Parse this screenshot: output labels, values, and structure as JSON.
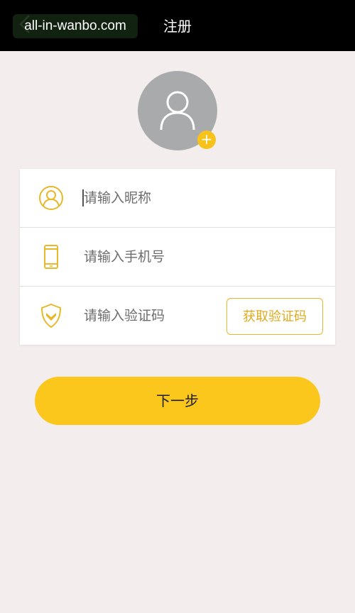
{
  "header": {
    "back_icon": "chevron-left-icon",
    "watermark": "all-in-wanbo.com",
    "title": "注册"
  },
  "avatar": {
    "icon": "person-icon",
    "add_icon": "plus-icon",
    "add_symbol": "+"
  },
  "form": {
    "nickname": {
      "icon": "user-circle-icon",
      "value": "",
      "placeholder": "请输入昵称"
    },
    "phone": {
      "icon": "phone-icon",
      "value": "",
      "placeholder": "请输入手机号"
    },
    "code": {
      "icon": "shield-icon",
      "value": "",
      "placeholder": "请输入验证码",
      "get_code_label": "获取验证码"
    }
  },
  "next_label": "下一步",
  "colors": {
    "accent": "#fcc71d",
    "accent_text": "#e0aa1c",
    "background": "#f3eded",
    "header": "#000000",
    "avatar_bg": "#a9aaab"
  }
}
